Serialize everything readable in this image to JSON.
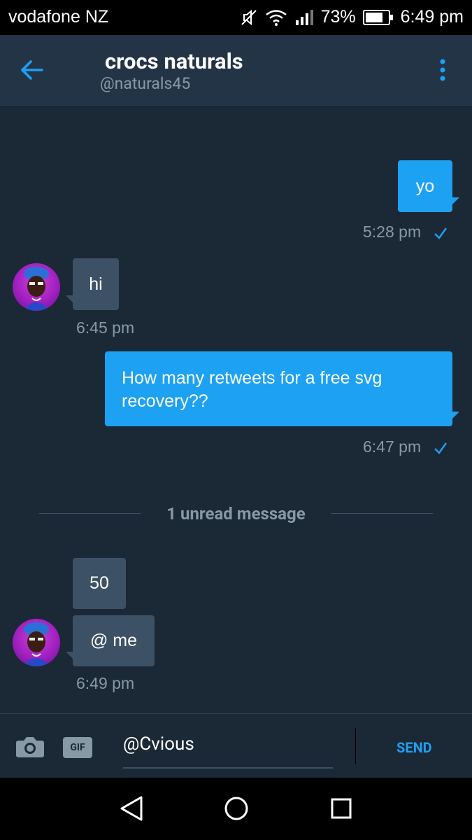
{
  "status_bar": {
    "carrier": "vodafone NZ",
    "battery": "73%",
    "time": "6:49 pm",
    "icons": [
      "mute-icon",
      "wifi-icon",
      "signal-icon",
      "battery-icon"
    ]
  },
  "header": {
    "name": "crocs naturals",
    "handle": "@naturals45",
    "back_icon": "back-arrow-icon",
    "menu_icon": "more-vertical-icon"
  },
  "messages": [
    {
      "direction": "outgoing",
      "text": "yo",
      "time": "5:28 pm",
      "read": true
    },
    {
      "direction": "incoming",
      "text": "hi",
      "time": "6:45 pm"
    },
    {
      "direction": "outgoing",
      "text_line1": "How many retweets for a free svg",
      "text_line2": "recovery??",
      "time": "6:47 pm",
      "read": true
    },
    {
      "direction": "incoming",
      "text": "50"
    },
    {
      "direction": "incoming",
      "text": "@ me",
      "time": "6:49 pm"
    }
  ],
  "unread_divider": "1 unread message",
  "composer": {
    "value": "@Cvious",
    "gif_label": "GIF",
    "send_label": "SEND"
  },
  "colors": {
    "background": "#1b2836",
    "header": "#243447",
    "accent": "#1da1f2",
    "incoming_bubble": "#3d5166",
    "muted_text": "#8899a6"
  }
}
